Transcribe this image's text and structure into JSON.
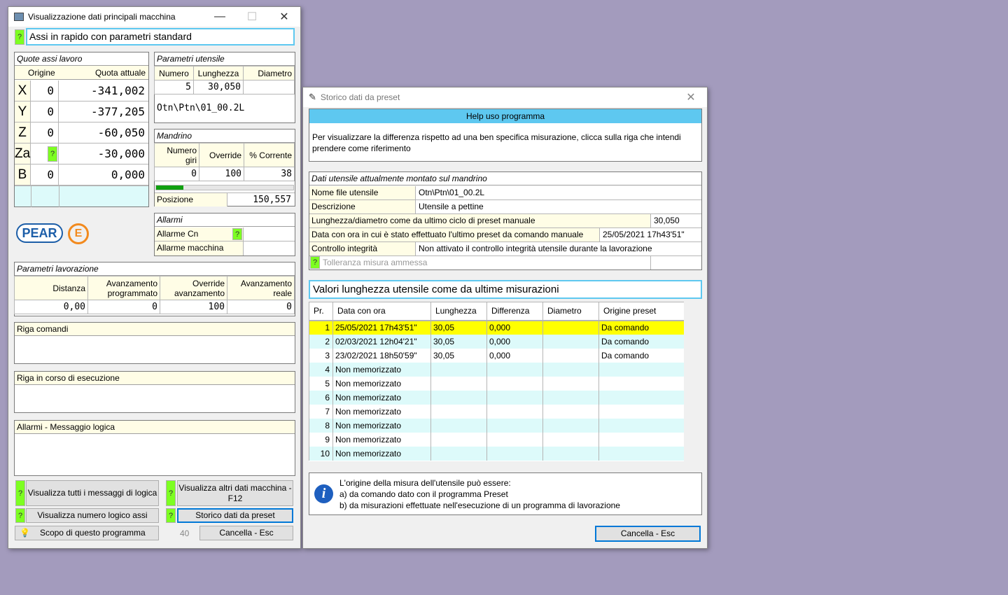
{
  "main": {
    "title": "Visualizzazione dati principali macchina",
    "status_text": "Assi in rapido con parametri standard",
    "quote": {
      "title": "Quote assi lavoro",
      "col_origine": "Origine",
      "col_quota": "Quota attuale",
      "axes": [
        {
          "name": "X",
          "origine": "0",
          "quota": "-341,002"
        },
        {
          "name": "Y",
          "origine": "0",
          "quota": "-377,205"
        },
        {
          "name": "Z",
          "origine": "0",
          "quota": "-60,050"
        },
        {
          "name": "Za",
          "origine": "",
          "quota": "-30,000"
        },
        {
          "name": "B",
          "origine": "0",
          "quota": "0,000"
        }
      ]
    },
    "utensile": {
      "title": "Parametri utensile",
      "col_numero": "Numero",
      "col_lunghezza": "Lunghezza",
      "col_diametro": "Diametro",
      "numero": "5",
      "lunghezza": "30,050",
      "diametro": "",
      "file": "Otn\\Ptn\\01_00.2L"
    },
    "mandrino": {
      "title": "Mandrino",
      "col_giri": "Numero giri",
      "col_override": "Override",
      "col_corrente": "% Corrente",
      "giri": "0",
      "override": "100",
      "corrente": "38",
      "progress": 0.2,
      "posizione_label": "Posizione",
      "posizione": "150,557"
    },
    "allarmi": {
      "title": "Allarmi",
      "cn_label": "Allarme Cn",
      "macchina_label": "Allarme macchina"
    },
    "logo_text": "PEAR",
    "lavorazione": {
      "title": "Parametri lavorazione",
      "col_distanza": "Distanza",
      "col_avanz_prog": "Avanzamento programmato",
      "col_override": "Override avanzamento",
      "col_avanz_reale": "Avanzamento reale",
      "distanza": "0,00",
      "avanz_prog": "0",
      "override": "100",
      "avanz_reale": "0"
    },
    "riga_comandi": "Riga comandi",
    "riga_esecuzione": "Riga in corso di esecuzione",
    "allarmi_logica": "Allarmi - Messaggio logica",
    "buttons": {
      "messaggi": "Visualizza tutti i messaggi di logica",
      "altri_dati": "Visualizza altri dati macchina - F12",
      "numero_logico": "Visualizza numero logico assi",
      "storico": "Storico dati da preset",
      "scopo": "Scopo di questo programma",
      "cancella": "Cancella - Esc"
    },
    "counter": "40"
  },
  "storico": {
    "title": "Storico dati da preset",
    "help_title": "Help uso programma",
    "help_text": "Per visualizzare la differenza rispetto ad una ben specifica misurazione, clicca sulla riga che intendi prendere come riferimento",
    "dati": {
      "title": "Dati utensile attualmente montato sul mandrino",
      "nome_file_label": "Nome file utensile",
      "nome_file": "Otn\\Ptn\\01_00.2L",
      "descrizione_label": "Descrizione",
      "descrizione": "Utensile a pettine",
      "lunghezza_label": "Lunghezza/diametro come da ultimo ciclo di preset manuale",
      "lunghezza": "30,050",
      "data_label": "Data con ora in cui è stato effettuato l'ultimo preset da comando manuale",
      "data": "25/05/2021 17h43'51\"",
      "integrita_label": "Controllo integrità",
      "integrita": "Non attivato il controllo integrità utensile durante la lavorazione",
      "tolleranza_placeholder": "Tolleranza misura ammessa"
    },
    "valori_title": "Valori lunghezza utensile come da ultime misurazioni",
    "columns": [
      "Pr.",
      "Data con ora",
      "Lunghezza",
      "Differenza",
      "Diametro",
      "Origine preset"
    ],
    "rows": [
      [
        "1",
        "25/05/2021 17h43'51\"",
        "30,05",
        "0,000",
        "",
        "Da comando"
      ],
      [
        "2",
        "02/03/2021 12h04'21\"",
        "30,05",
        "0,000",
        "",
        "Da comando"
      ],
      [
        "3",
        "23/02/2021 18h50'59\"",
        "30,05",
        "0,000",
        "",
        "Da comando"
      ],
      [
        "4",
        "Non memorizzato",
        "",
        "",
        "",
        ""
      ],
      [
        "5",
        "Non memorizzato",
        "",
        "",
        "",
        ""
      ],
      [
        "6",
        "Non memorizzato",
        "",
        "",
        "",
        ""
      ],
      [
        "7",
        "Non memorizzato",
        "",
        "",
        "",
        ""
      ],
      [
        "8",
        "Non memorizzato",
        "",
        "",
        "",
        ""
      ],
      [
        "9",
        "Non memorizzato",
        "",
        "",
        "",
        ""
      ],
      [
        "10",
        "Non memorizzato",
        "",
        "",
        "",
        ""
      ]
    ],
    "info_lines": [
      "L'origine della misura dell'utensile può essere:",
      "a) da comando dato con il programma Preset",
      "b) da misurazioni effettuate nell'esecuzione di un programma di lavorazione"
    ],
    "cancel_label": "Cancella - Esc"
  },
  "colors": {
    "desktop": "#a39bbd",
    "help_header": "#5ec8f0",
    "selected_row": "#ffff00",
    "alt_row": "#ddfafa",
    "question_green": "#7dff21",
    "progress_green": "#10a010",
    "pear_blue": "#1c5ea8",
    "logo_orange": "#f28a1e"
  }
}
